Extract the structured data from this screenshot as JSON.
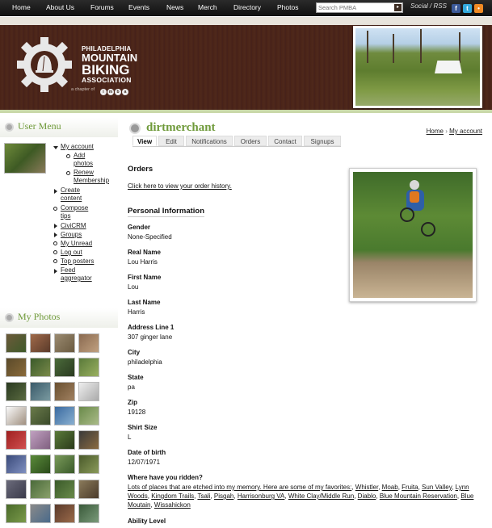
{
  "nav": {
    "items": [
      "Home",
      "About Us",
      "Forums",
      "Events",
      "News",
      "Merch",
      "Directory",
      "Photos"
    ],
    "search_placeholder": "Search PMBA",
    "social_label": "Social / RSS",
    "social_icons": [
      "facebook-icon",
      "twitter-icon",
      "rss-icon"
    ]
  },
  "logo": {
    "line1": "PHILADELPHIA",
    "line2": "MOUNTAIN",
    "line3": "BIKING",
    "line4": "ASSOCIATION",
    "chapter_text": "a chapter of",
    "imba_letters": [
      "i",
      "m",
      "b",
      "a"
    ]
  },
  "sidebar": {
    "user_menu_title": "User Menu",
    "my_photos_title": "My Photos",
    "menu": {
      "my_account": "My account",
      "add_photos": [
        "Add",
        "photos"
      ],
      "renew_membership": [
        "Renew",
        "Membership"
      ],
      "create_content": [
        "Create",
        "content"
      ],
      "compose_tips": [
        "Compose",
        "tips"
      ],
      "civicrm": "CiviCRM",
      "groups": "Groups",
      "my_unread": "My Unread",
      "log_out": "Log out",
      "top_posters": "Top posters",
      "feed_aggregator": [
        "Feed",
        "aggregator"
      ]
    }
  },
  "main": {
    "title": "dirtmerchant",
    "breadcrumb": {
      "home": "Home",
      "sep": "›",
      "my_account": "My account"
    },
    "tabs": [
      "View",
      "Edit",
      "Notifications",
      "Orders",
      "Contact",
      "Signups"
    ],
    "active_tab": "View",
    "orders_heading": "Orders",
    "orders_link": "Click here to view your order history.",
    "personal_heading": "Personal Information",
    "fields": [
      {
        "label": "Gender",
        "value": "None-Specified"
      },
      {
        "label": "Real Name",
        "value": "Lou Harris"
      },
      {
        "label": "First Name",
        "value": "Lou"
      },
      {
        "label": "Last Name",
        "value": "Harris"
      },
      {
        "label": "Address Line 1",
        "value": "307 ginger lane"
      },
      {
        "label": "City",
        "value": "philadelphia"
      },
      {
        "label": "State",
        "value": "pa"
      },
      {
        "label": "Zip",
        "value": "19128"
      },
      {
        "label": "Shirt Size",
        "value": "L"
      },
      {
        "label": "Date of birth",
        "value": "12/07/1971"
      }
    ],
    "ridden_label": "Where have you ridden?",
    "ridden_intro": "Lots of places that are etched into my memory. Here are some of my favorites:",
    "ridden_places": [
      "Whistler",
      "Moab",
      "Fruita",
      "Sun Valley",
      "Lynn Woods",
      "Kingdom Trails",
      "Tsali",
      "Pisgah",
      "Harrisonburg VA",
      "White Clay/Middle Run",
      "Diablo",
      "Blue Mountain Reservation",
      "Blue Moutain",
      "Wissahickon"
    ],
    "ability_label": "Ability Level"
  }
}
